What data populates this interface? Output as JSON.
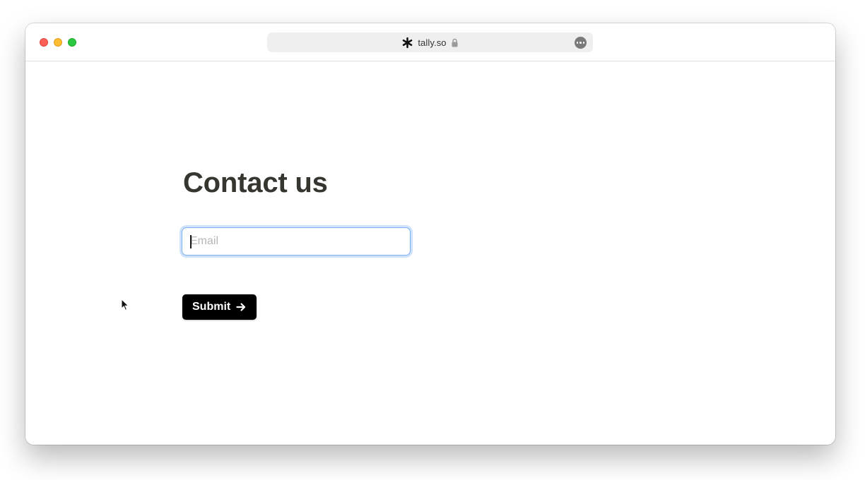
{
  "browser": {
    "url": "tally.so",
    "site_icon": "asterisk-logo-icon",
    "lock_icon": "lock-icon",
    "more_icon": "ellipsis-circle-icon"
  },
  "form": {
    "title": "Contact us",
    "email_placeholder": "Email",
    "email_value": "",
    "submit_label": "Submit",
    "submit_icon": "arrow-right-icon"
  },
  "colors": {
    "title_text": "#37352f",
    "focus_ring": "#cfe2fb",
    "button_bg": "#000000",
    "close": "#fe5f57",
    "minimize": "#febc2e",
    "zoom": "#28c840"
  }
}
